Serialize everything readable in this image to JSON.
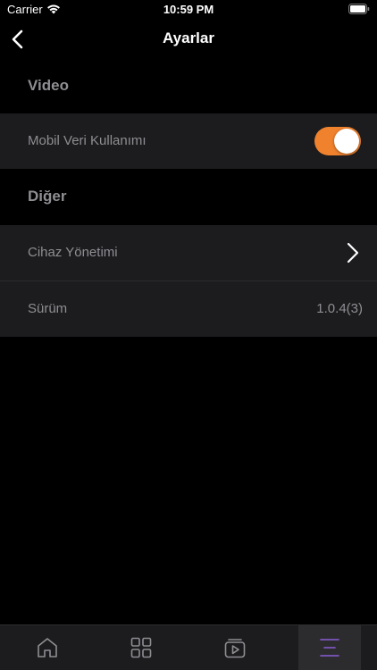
{
  "status_bar": {
    "carrier": "Carrier",
    "time": "10:59 PM"
  },
  "nav": {
    "title": "Ayarlar"
  },
  "sections": {
    "video": {
      "header": "Video",
      "mobile_data_label": "Mobil Veri Kullanımı",
      "mobile_data_enabled": true
    },
    "other": {
      "header": "Diğer",
      "device_management_label": "Cihaz Yönetimi",
      "version_label": "Sürüm",
      "version_value": "1.0.4(3)"
    }
  },
  "tab_bar": {
    "tabs": [
      {
        "icon": "home-icon",
        "active": false
      },
      {
        "icon": "grid-icon",
        "active": false
      },
      {
        "icon": "video-library-icon",
        "active": false
      },
      {
        "icon": "menu-icon",
        "active": true
      }
    ]
  },
  "colors": {
    "accent": "#f0822e",
    "active_tab": "#8a5cd6",
    "inactive_icon": "#8e8e93"
  }
}
